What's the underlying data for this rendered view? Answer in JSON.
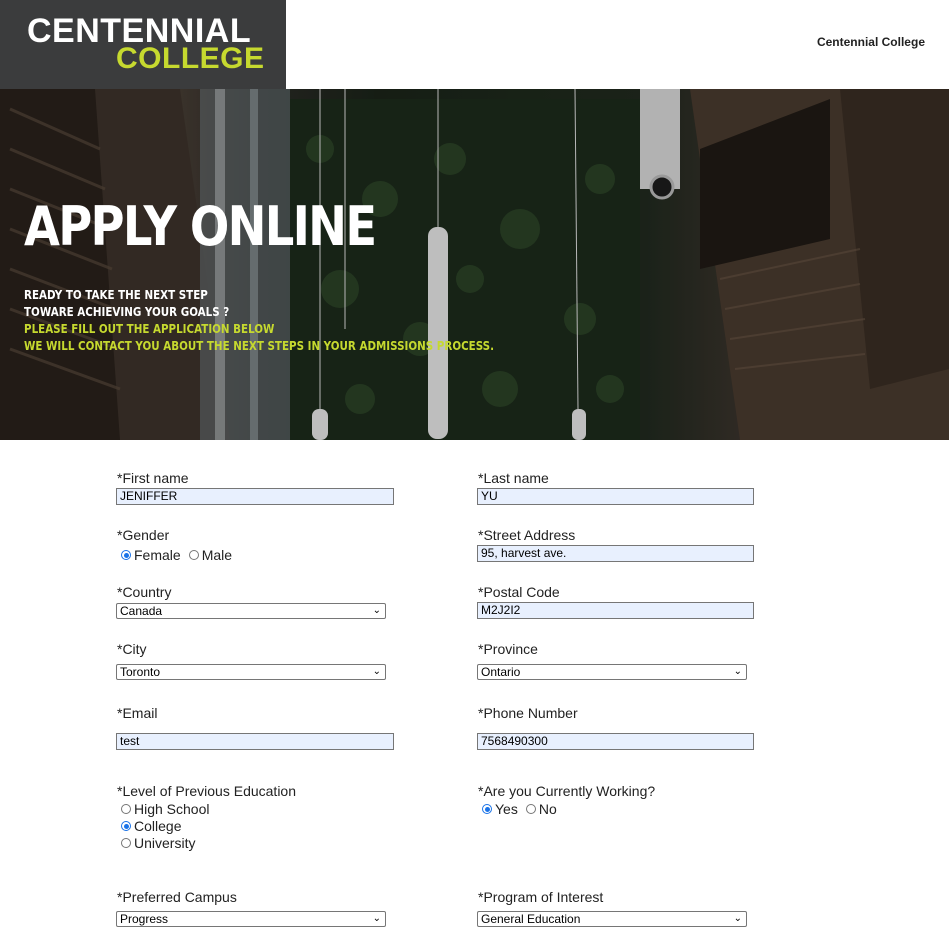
{
  "header": {
    "logo_line1": "CENTENNIAL",
    "logo_line2": "COLLEGE",
    "nav_link": "Centennial College"
  },
  "hero": {
    "title": "APPLY ONLINE",
    "line1": "READY TO TAKE THE NEXT STEP",
    "line2": "TOWARE ACHIEVING YOUR GOALS ?",
    "line3": "PLEASE FILL OUT THE APPLICATION BELOW",
    "line4": "WE WILL CONTACT YOU ABOUT THE NEXT STEPS IN YOUR ADMISSIONS PROCESS."
  },
  "form": {
    "first_name": {
      "label": "*First name",
      "value": "JENIFFER"
    },
    "last_name": {
      "label": "*Last name",
      "value": "YU"
    },
    "gender": {
      "label": "*Gender",
      "options": [
        "Female",
        "Male"
      ],
      "selected": "Female"
    },
    "street_address": {
      "label": "*Street Address",
      "value": "95, harvest ave."
    },
    "country": {
      "label": "*Country",
      "value": "Canada"
    },
    "postal_code": {
      "label": "*Postal Code",
      "value": "M2J2I2"
    },
    "city": {
      "label": "*City",
      "value": "Toronto"
    },
    "province": {
      "label": "*Province",
      "value": "Ontario"
    },
    "email": {
      "label": "*Email",
      "value": "test"
    },
    "phone": {
      "label": "*Phone Number",
      "value": "7568490300"
    },
    "education": {
      "label": "*Level of Previous Education",
      "options": [
        "High School",
        "College",
        "University"
      ],
      "selected": "College"
    },
    "working": {
      "label": "*Are you Currently Working?",
      "options": [
        "Yes",
        "No"
      ],
      "selected": "Yes"
    },
    "campus": {
      "label": "*Preferred Campus",
      "value": "Progress"
    },
    "program": {
      "label": "*Program of Interest",
      "value": "General Education"
    }
  },
  "colors": {
    "accent_lime": "#c6d92f",
    "logo_bg": "#3b3c3d",
    "autofill_bg": "#e8f0fe",
    "radio_checked": "#1a73e8"
  }
}
